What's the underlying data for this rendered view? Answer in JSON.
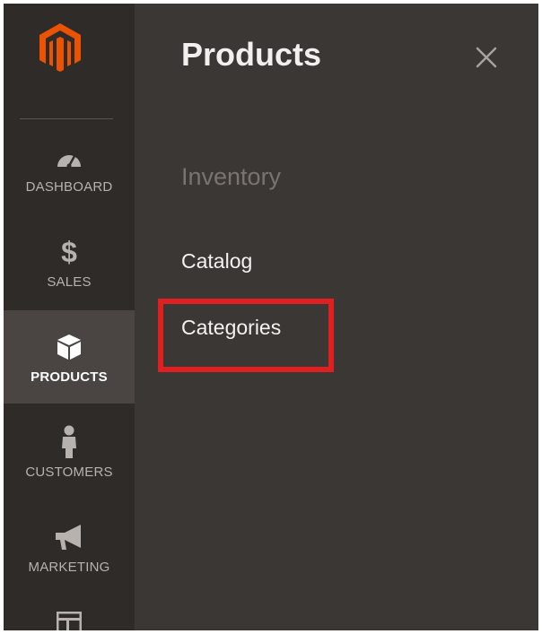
{
  "sidebar": {
    "logo_icon": "magento-logo-icon",
    "items": [
      {
        "label": "DASHBOARD",
        "icon": "dashboard-icon",
        "active": false
      },
      {
        "label": "SALES",
        "icon": "dollar-icon",
        "active": false
      },
      {
        "label": "PRODUCTS",
        "icon": "box-icon",
        "active": true
      },
      {
        "label": "CUSTOMERS",
        "icon": "person-icon",
        "active": false
      },
      {
        "label": "MARKETING",
        "icon": "megaphone-icon",
        "active": false
      },
      {
        "label": "",
        "icon": "layout-icon",
        "active": false
      }
    ]
  },
  "panel": {
    "title": "Products",
    "close_icon": "close-icon",
    "section_heading": "Inventory",
    "links": [
      {
        "label": "Catalog"
      },
      {
        "label": "Categories",
        "highlighted": true
      }
    ]
  },
  "colors": {
    "sidebar_bg": "#2f2b29",
    "panel_bg": "#3b3735",
    "active_item_bg": "#4a4542",
    "brand_orange": "#eb5202",
    "highlight_red": "#e02020"
  }
}
